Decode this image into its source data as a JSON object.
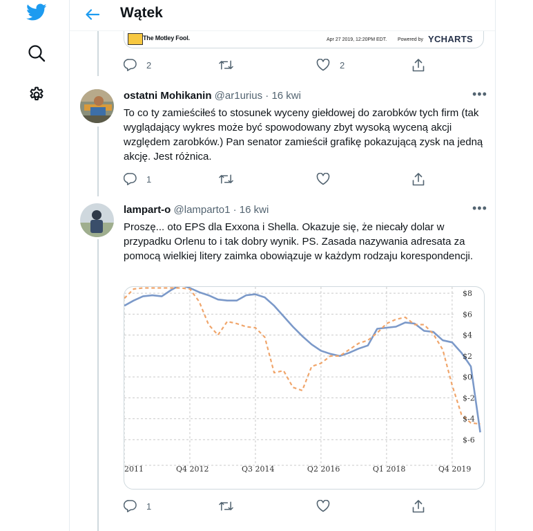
{
  "header": {
    "title": "Wątek"
  },
  "embed": {
    "brand": "The Motley Fool.",
    "date": "Apr 27 2019, 12:20PM EDT.",
    "powered": "Powered by",
    "ycharts": "YCHARTS"
  },
  "tweet0": {
    "replies": "2",
    "likes": "2"
  },
  "tweet1": {
    "name": "ostatni Mohikanin",
    "handle": "@ar1urius",
    "sep": "·",
    "time": "16 kwi",
    "text": "To co ty zamieściłeś to stosunek wyceny giełdowej do zarobków tych firm (tak wyglądający wykres może być spowodowany zbyt wysoką wyceną akcji względem zarobków.) Pan senator zamieścił grafikę pokazującą zysk na jedną akcję. Jest różnica.",
    "replies": "1"
  },
  "tweet2": {
    "name": "lampart-o",
    "handle": "@lamparto1",
    "sep": "·",
    "time": "16 kwi",
    "text": "Proszę... oto EPS dla Exxona i Shella. Okazuje się, że niecały dolar w przypadku Orlenu to i tak dobry wynik. PS. Zasada nazywania adresata za pomocą wielkiej litery zaimka obowiązuje w każdym rodzaju korespondencji.",
    "replies": "1"
  },
  "colors": {
    "accent": "#1d9bf0",
    "series_solid": "#7b99c9",
    "series_dashed": "#f0a56b"
  },
  "chart_data": {
    "type": "line",
    "x_tick_labels": [
      "2011",
      "Q4 2012",
      "Q3 2014",
      "Q2 2016",
      "Q1 2018",
      "Q4 2019"
    ],
    "x_ticks": [
      2011.0,
      2012.75,
      2014.5,
      2016.25,
      2018.0,
      2019.75
    ],
    "y_tick_labels": [
      "$8",
      "$6",
      "$4",
      "$2",
      "$0",
      "$-2",
      "$-4",
      "$-6"
    ],
    "y_ticks": [
      8,
      6,
      4,
      2,
      0,
      -2,
      -4,
      -6
    ],
    "xlim": [
      2011.0,
      2020.6
    ],
    "ylim": [
      -6.8,
      8.6
    ],
    "series": [
      {
        "style": "solid",
        "x": [
          2011.0,
          2011.25,
          2011.5,
          2011.75,
          2012.0,
          2012.25,
          2012.5,
          2012.75,
          2013.0,
          2013.25,
          2013.5,
          2013.75,
          2014.0,
          2014.25,
          2014.5,
          2014.75,
          2015.0,
          2015.25,
          2015.5,
          2015.75,
          2016.0,
          2016.25,
          2016.5,
          2016.75,
          2017.0,
          2017.25,
          2017.5,
          2017.75,
          2018.0,
          2018.25,
          2018.5,
          2018.75,
          2019.0,
          2019.25,
          2019.5,
          2019.75,
          2020.0,
          2020.25,
          2020.5
        ],
        "y": [
          6.8,
          7.3,
          7.7,
          7.8,
          7.7,
          8.3,
          8.8,
          8.5,
          8.1,
          7.8,
          7.4,
          7.3,
          7.3,
          7.8,
          7.9,
          7.6,
          6.8,
          5.8,
          4.8,
          3.9,
          3.1,
          2.5,
          2.2,
          2.0,
          2.3,
          2.7,
          3.0,
          4.6,
          4.7,
          4.8,
          5.2,
          5.1,
          4.4,
          4.3,
          3.5,
          3.3,
          2.3,
          1.0,
          -5.3
        ]
      },
      {
        "style": "dashed",
        "x": [
          2011.0,
          2011.25,
          2011.5,
          2011.75,
          2012.0,
          2012.25,
          2012.5,
          2012.75,
          2013.0,
          2013.25,
          2013.5,
          2013.75,
          2014.0,
          2014.25,
          2014.5,
          2014.75,
          2015.0,
          2015.25,
          2015.5,
          2015.75,
          2016.0,
          2016.25,
          2016.5,
          2016.75,
          2017.0,
          2017.25,
          2017.5,
          2017.75,
          2018.0,
          2018.25,
          2018.5,
          2018.75,
          2019.0,
          2019.25,
          2019.5,
          2019.75,
          2020.0,
          2020.25,
          2020.5
        ],
        "y": [
          7.5,
          8.4,
          8.5,
          8.5,
          8.5,
          8.5,
          8.5,
          8.4,
          7.2,
          5.0,
          4.0,
          5.3,
          5.1,
          4.8,
          4.7,
          3.8,
          0.4,
          0.6,
          -1.0,
          -1.3,
          1.0,
          1.3,
          2.0,
          2.0,
          2.6,
          3.2,
          3.5,
          4.2,
          5.1,
          5.5,
          5.7,
          5.0,
          5.0,
          4.1,
          2.6,
          -0.8,
          -3.6,
          -4.4,
          -4.5
        ]
      }
    ]
  }
}
